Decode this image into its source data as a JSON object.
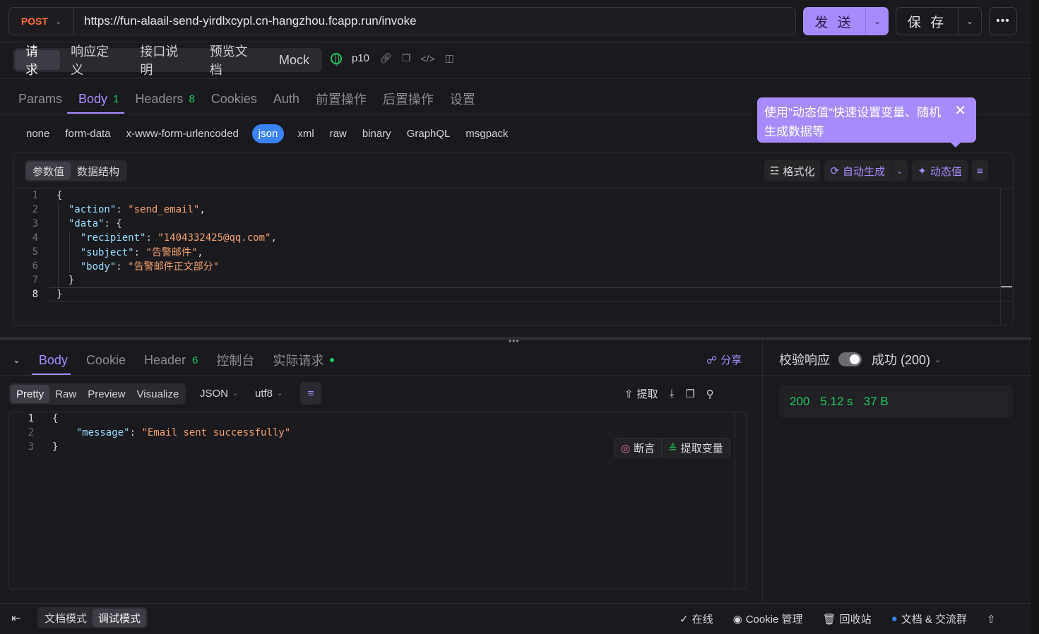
{
  "request": {
    "method": "POST",
    "url": "https://fun-alaail-send-yirdlxcypl.cn-hangzhou.fcapp.run/invoke",
    "send_label": "发 送",
    "save_label": "保 存"
  },
  "mode_tabs": [
    "请求",
    "响应定义",
    "接口说明",
    "预览文档",
    "Mock"
  ],
  "env_name": "p10",
  "request_tabs": [
    {
      "label": "Params",
      "count": ""
    },
    {
      "label": "Body",
      "count": "1"
    },
    {
      "label": "Headers",
      "count": "8"
    },
    {
      "label": "Cookies",
      "count": ""
    },
    {
      "label": "Auth",
      "count": ""
    },
    {
      "label": "前置操作",
      "count": ""
    },
    {
      "label": "后置操作",
      "count": ""
    },
    {
      "label": "设置",
      "count": ""
    }
  ],
  "body_types": [
    "none",
    "form-data",
    "x-www-form-urlencoded",
    "json",
    "xml",
    "raw",
    "binary",
    "GraphQL",
    "msgpack"
  ],
  "active_body_type": "json",
  "tooltip_text": "使用\"动态值\"快速设置变量、随机生成数据等",
  "editor": {
    "seg_tabs": [
      "参数值",
      "数据结构"
    ],
    "format_label": "格式化",
    "auto_gen_label": "自动生成",
    "dynamic_label": "动态值",
    "lines": [
      {
        "n": "1",
        "indent": "",
        "key": "",
        "sep": "{",
        "val": "",
        "end": ""
      },
      {
        "n": "2",
        "indent": "  ",
        "key": "\"action\"",
        "sep": ": ",
        "val": "\"send_email\"",
        "end": ","
      },
      {
        "n": "3",
        "indent": "  ",
        "key": "\"data\"",
        "sep": ": {",
        "val": "",
        "end": ""
      },
      {
        "n": "4",
        "indent": "    ",
        "key": "\"recipient\"",
        "sep": ": ",
        "val": "\"1404332425@qq.com\"",
        "end": ","
      },
      {
        "n": "5",
        "indent": "    ",
        "key": "\"subject\"",
        "sep": ": ",
        "val": "\"告警邮件\"",
        "end": ","
      },
      {
        "n": "6",
        "indent": "    ",
        "key": "\"body\"",
        "sep": ": ",
        "val": "\"告警邮件正文部分\"",
        "end": ""
      },
      {
        "n": "7",
        "indent": "  ",
        "key": "",
        "sep": "}",
        "val": "",
        "end": ""
      },
      {
        "n": "8",
        "indent": "",
        "key": "",
        "sep": "}",
        "val": "",
        "end": ""
      }
    ]
  },
  "response": {
    "tabs": [
      {
        "label": "Body",
        "count": ""
      },
      {
        "label": "Cookie",
        "count": ""
      },
      {
        "label": "Header",
        "count": "6"
      },
      {
        "label": "控制台",
        "count": ""
      },
      {
        "label": "实际请求",
        "count": ""
      }
    ],
    "share_label": "分享",
    "format_tabs": [
      "Pretty",
      "Raw",
      "Preview",
      "Visualize"
    ],
    "format_type": "JSON",
    "encoding": "utf8",
    "extract_label": "提取",
    "assert_label": "断言",
    "extract_var_label": "提取变量",
    "lines": [
      {
        "n": "1",
        "indent": "",
        "key": "",
        "sep": "{",
        "val": ""
      },
      {
        "n": "2",
        "indent": "    ",
        "key": "\"message\"",
        "sep": ": ",
        "val": "\"Email sent successfully\""
      },
      {
        "n": "3",
        "indent": "",
        "key": "",
        "sep": "}",
        "val": ""
      }
    ],
    "verify_label": "校验响应",
    "status_label": "成功 (200)",
    "status_code": "200",
    "time": "5.12 s",
    "size": "37 B"
  },
  "footer": {
    "doc_mode": "文档模式",
    "debug_mode": "调试模式",
    "online": "在线",
    "cookie_mgr": "Cookie 管理",
    "recycle": "回收站",
    "docs_group": "文档 & 交流群"
  },
  "colors": {
    "accent": "#a78bfa",
    "method": "#ff6a38",
    "success": "#22c55e",
    "json_active": "#3b82f6"
  }
}
